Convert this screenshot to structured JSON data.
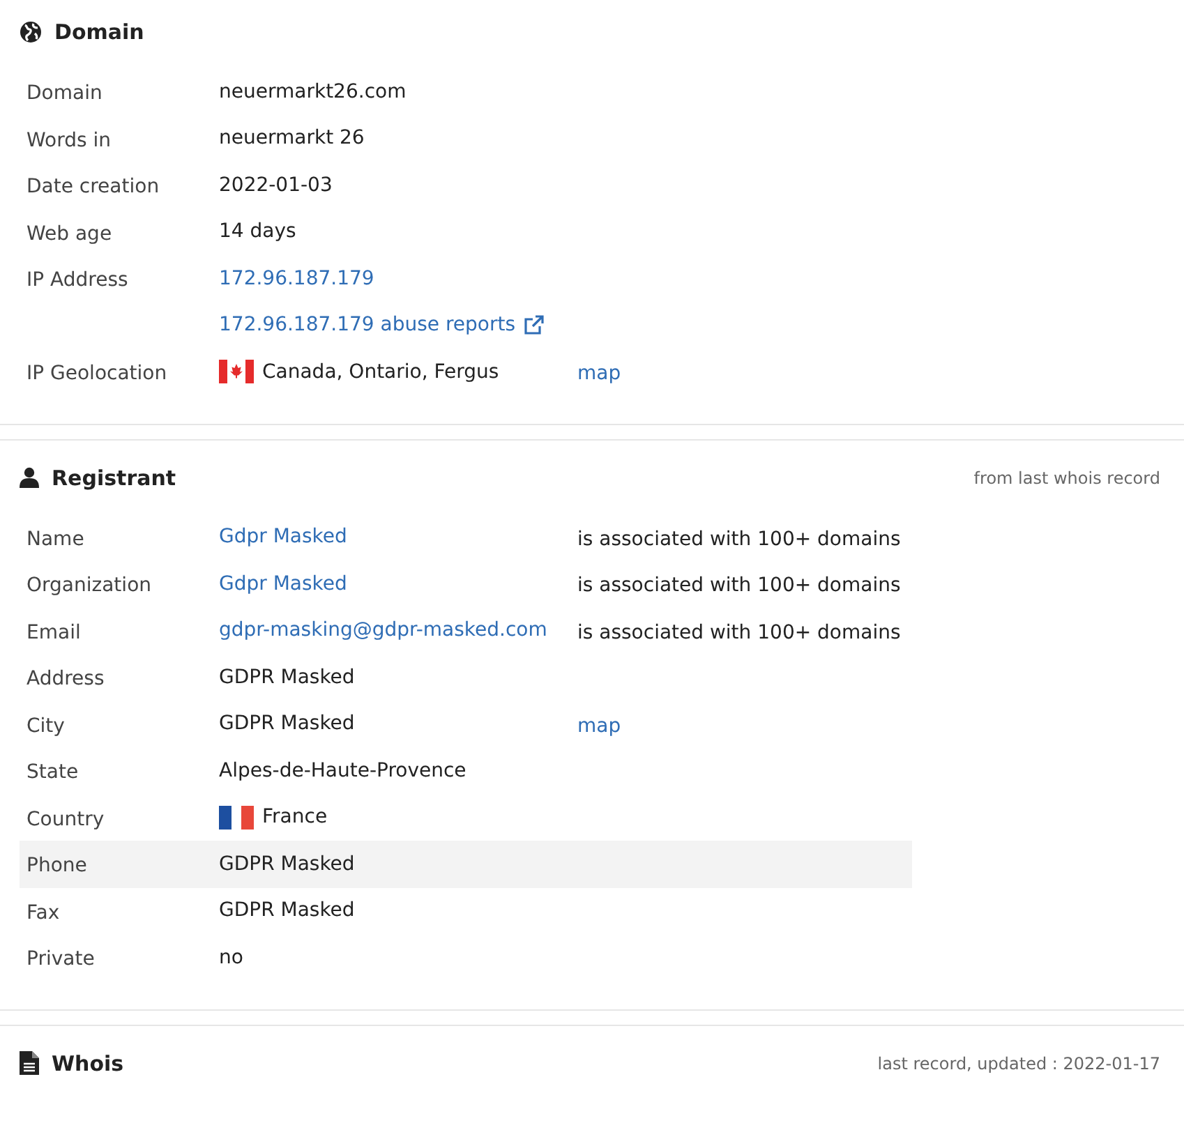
{
  "sections": [
    {
      "kind": "domain",
      "title": "Domain",
      "rows": [
        {
          "label": "Domain",
          "value": {
            "text": "neuermarkt26.com",
            "link": false
          },
          "highlighted": false
        },
        {
          "label": "Words in",
          "value": {
            "text": "neuermarkt 26",
            "link": false
          },
          "highlighted": false
        },
        {
          "label": "Date creation",
          "value": {
            "text": "2022-01-03",
            "link": false
          },
          "highlighted": false
        },
        {
          "label": "Web age",
          "value": {
            "text": "14 days",
            "link": false
          },
          "highlighted": false
        },
        {
          "label": "IP Address",
          "value": {
            "text": "172.96.187.179",
            "link": true
          },
          "highlighted": false
        },
        {
          "value": {
            "text": "172.96.187.179 abuse reports",
            "link": true,
            "external": true
          },
          "highlighted": false
        },
        {
          "label": "IP Geolocation",
          "flag": {
            "kind": "canada"
          },
          "value": {
            "text": "Canada, Ontario, Fergus",
            "link": false
          },
          "extra": {
            "text": "map",
            "link": true
          },
          "highlighted": false
        }
      ]
    },
    {
      "kind": "registrant",
      "title": "Registrant",
      "note": "from last whois record",
      "rows": [
        {
          "label": "Name",
          "value": {
            "text": "Gdpr Masked",
            "link": true
          },
          "extra": {
            "text": "is associated with 100+ domains",
            "link": false
          },
          "highlighted": false
        },
        {
          "label": "Organization",
          "value": {
            "text": "Gdpr Masked",
            "link": true
          },
          "extra": {
            "text": "is associated with 100+ domains",
            "link": false
          },
          "highlighted": false
        },
        {
          "label": "Email",
          "value": {
            "text": "gdpr-masking@gdpr-masked.com",
            "link": true
          },
          "extra": {
            "text": "is associated with 100+ domains",
            "link": false
          },
          "highlighted": false
        },
        {
          "label": "Address",
          "value": {
            "text": "GDPR Masked",
            "link": false
          },
          "highlighted": false
        },
        {
          "label": "City",
          "value": {
            "text": "GDPR Masked",
            "link": false
          },
          "extra": {
            "text": "map",
            "link": true
          },
          "highlighted": false
        },
        {
          "label": "State",
          "value": {
            "text": "Alpes-de-Haute-Provence",
            "link": false
          },
          "highlighted": false
        },
        {
          "label": "Country",
          "flag": {
            "kind": "france"
          },
          "value": {
            "text": "France",
            "link": false
          },
          "highlighted": false
        },
        {
          "label": "Phone",
          "value": {
            "text": "GDPR Masked",
            "link": false
          },
          "highlighted": true
        },
        {
          "label": "Fax",
          "value": {
            "text": "GDPR Masked",
            "link": false
          },
          "highlighted": false
        },
        {
          "label": "Private",
          "value": {
            "text": "no",
            "link": false
          },
          "highlighted": false
        }
      ]
    },
    {
      "kind": "whois",
      "title": "Whois",
      "note": "last record, updated : 2022-01-17"
    }
  ]
}
